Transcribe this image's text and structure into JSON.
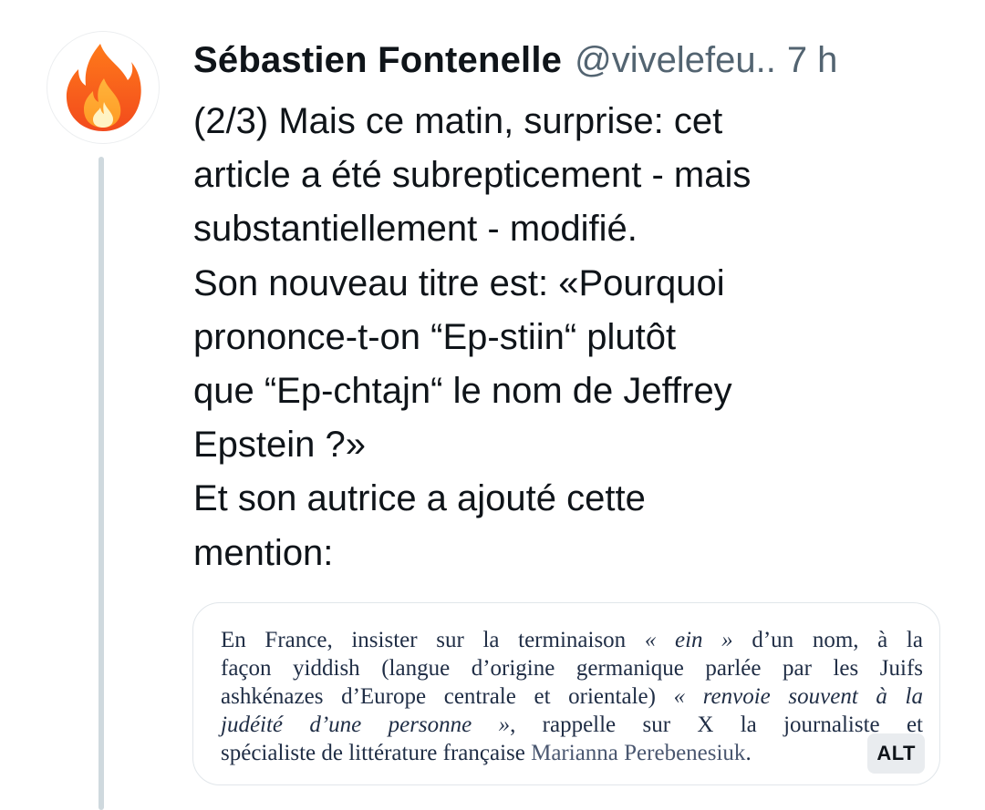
{
  "avatar": {
    "icon": "fire-icon"
  },
  "tweet": {
    "display_name": "Sébastien Fontenelle",
    "handle": "@vivelefeu..",
    "time": "7 h",
    "lines": [
      "(2/3) Mais ce matin, surprise: cet",
      "article a été subrepticement - mais",
      "substantiellement - modifié.",
      "Son nouveau titre est: «Pourquoi",
      "prononce-t-on “Ep-stiin“ plutôt",
      "que “Ep-chtajn“ le nom de Jeffrey",
      "Epstein ?»",
      "Et son autrice a ajouté cette",
      "mention:"
    ]
  },
  "media": {
    "alt_label": "ALT",
    "quote": {
      "l1a": "En France, insister sur la terminaison ",
      "l1b": "« ein »",
      "l1c": " d’un nom, à la",
      "l2": "façon yiddish (langue d’origine germanique parlée par les Juifs",
      "l3a": "ashkénazes d’Europe centrale et orientale) ",
      "l3b": "« renvoie souvent à la",
      "l4a": "judéité d’une personne »",
      "l4b": ", rappelle sur X la journaliste et",
      "l5a": "spécialiste de littérature française ",
      "l5b": "Marianna Perebenesiuk",
      "l5c": "."
    }
  },
  "colors": {
    "text": "#0f1419",
    "secondary": "#536471",
    "thread_line": "#cfd9de",
    "quote_text": "#1f2d45"
  }
}
